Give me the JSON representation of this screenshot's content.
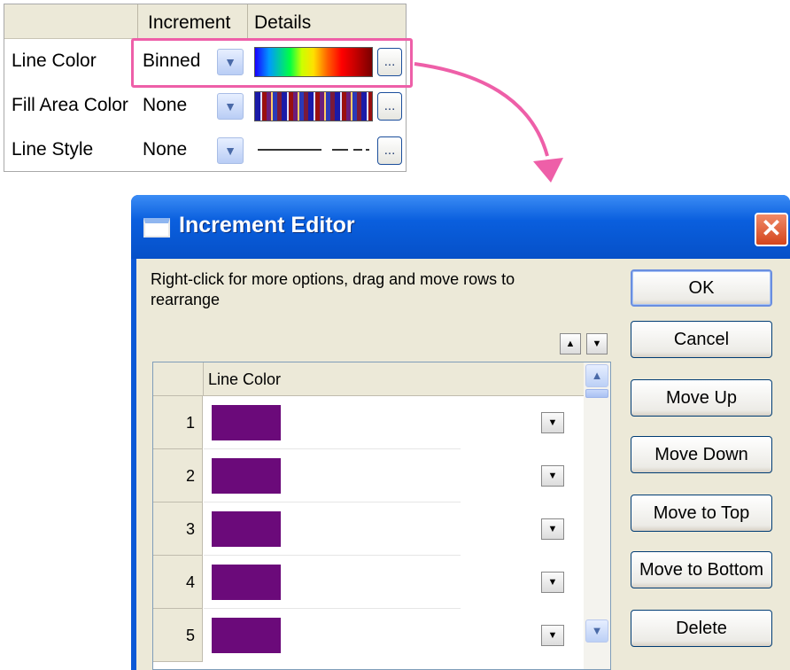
{
  "property_grid": {
    "headers": {
      "increment": "Increment",
      "details": "Details"
    },
    "rows": [
      {
        "label": "Line Color",
        "increment": "Binned",
        "details": "rainbow-gradient"
      },
      {
        "label": "Fill Area Color",
        "increment": "None",
        "details": "color-bars"
      },
      {
        "label": "Line Style",
        "increment": "None",
        "details": "line-style-sample"
      }
    ],
    "combo_icon": "chevron-down-icon",
    "browse_label": "..."
  },
  "dialog": {
    "title": "Increment Editor",
    "close_label": "✕",
    "instructions": "Right-click for more options, drag and move rows to  rearrange",
    "buttons": {
      "ok": "OK",
      "cancel": "Cancel",
      "move_up": "Move Up",
      "move_down": "Move Down",
      "move_to_top": "Move to Top",
      "move_to_bottom": "Move to Bottom",
      "delete": "Delete"
    },
    "grid": {
      "column": "Line Color",
      "rows": [
        {
          "index": "1",
          "color": "#6b0a7a"
        },
        {
          "index": "2",
          "color": "#6b0a7a"
        },
        {
          "index": "3",
          "color": "#6b0a7a"
        },
        {
          "index": "4",
          "color": "#6b0a7a"
        },
        {
          "index": "5",
          "color": "#6b0a7a"
        }
      ]
    }
  },
  "colors": {
    "highlight": "#ee5fa8",
    "titlebar": "#0a58d6",
    "swatch_purple": "#6b0a7a"
  }
}
